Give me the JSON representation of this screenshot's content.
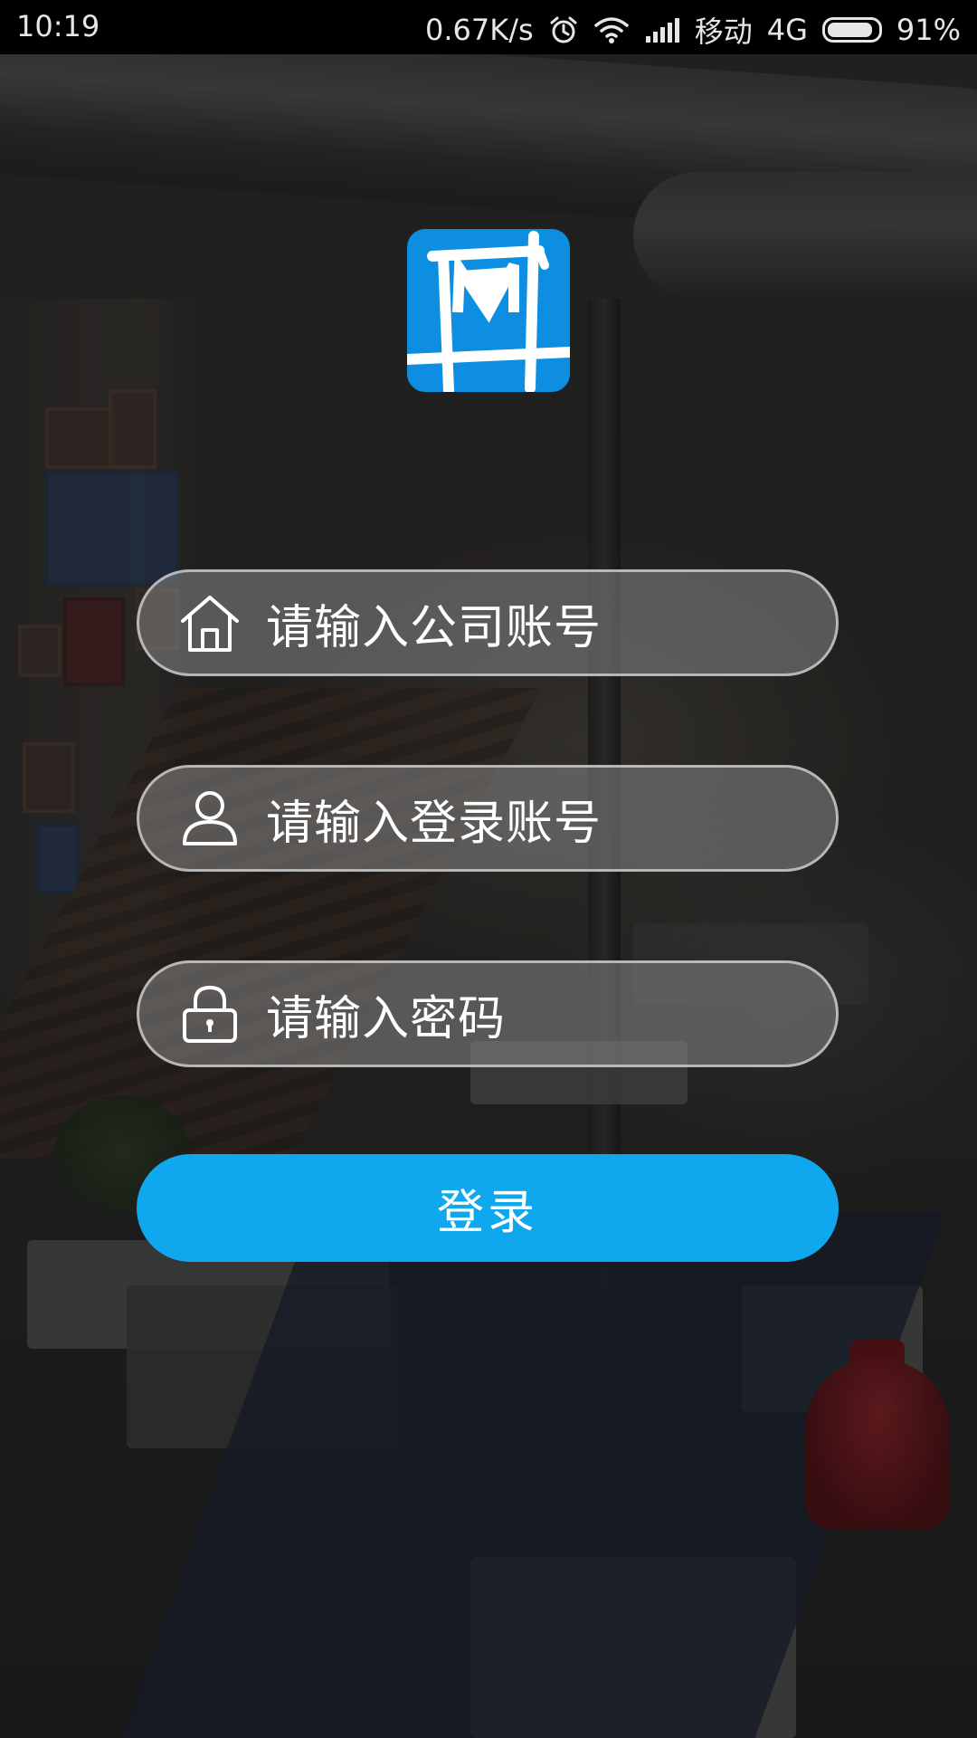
{
  "status_bar": {
    "time": "10:19",
    "network_speed": "0.67K/s",
    "carrier": "移动",
    "network_type": "4G",
    "battery": "91%",
    "battery_level": 0.91,
    "icons": [
      "alarm-icon",
      "wifi-icon",
      "signal-icon",
      "battery-icon"
    ]
  },
  "logo": {
    "icon": "app-logo",
    "color": "#0e8ee0"
  },
  "form": {
    "company_placeholder": "请输入公司账号",
    "company_icon": "house-icon",
    "user_placeholder": "请输入登录账号",
    "user_icon": "person-icon",
    "password_placeholder": "请输入密码",
    "password_icon": "lock-icon",
    "login_label": "登录",
    "login_color": "#0fa8ef"
  }
}
